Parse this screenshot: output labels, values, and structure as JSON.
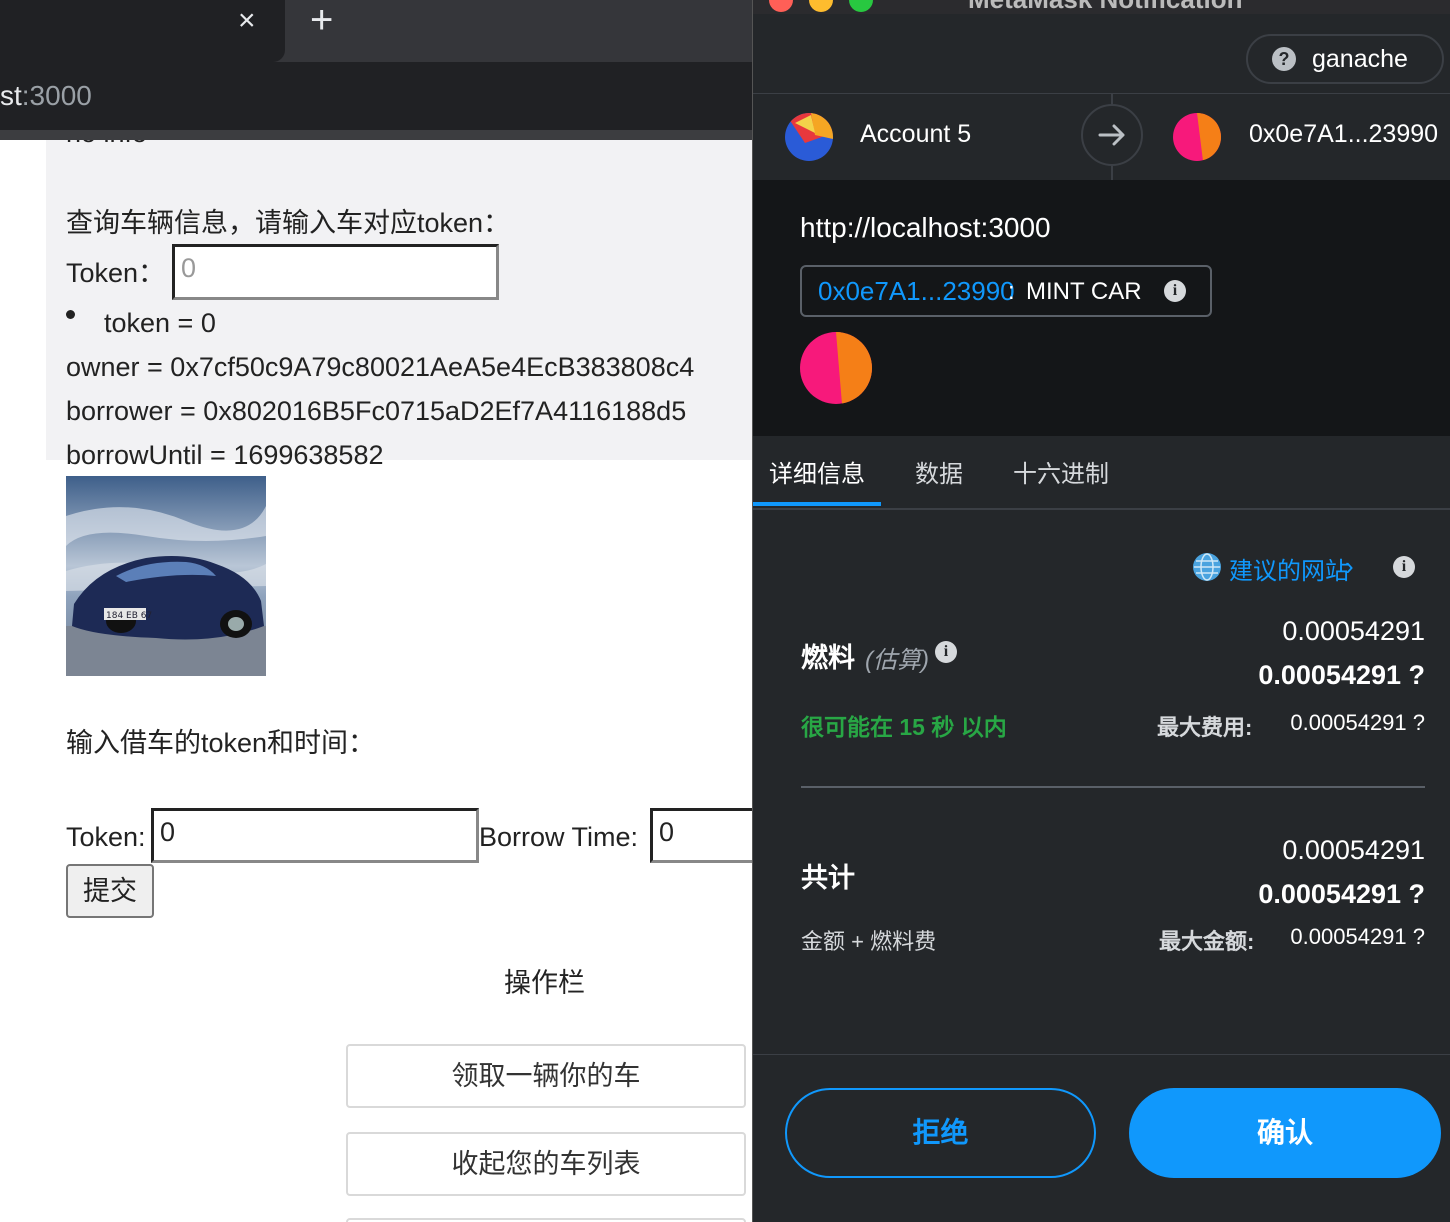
{
  "browser": {
    "tab_close": "×",
    "new_tab": "+",
    "url_host": "st",
    "url_port": ":3000"
  },
  "page": {
    "cut_text": "no info",
    "query_title": "查询车辆信息，请输入车对应token：",
    "token_label": "Token：",
    "token_placeholder": "0",
    "token_line": "token = 0",
    "owner_line": "owner = 0x7cf50c9A79c80021AeA5e4EcB383808c4",
    "borrower_line": "borrower = 0x802016B5Fc0715aD2Ef7A4116188d5",
    "borrow_until_line": "borrowUntil = 1699638582",
    "car_plate": "184 EB 67",
    "borrow_title": "输入借车的token和时间：",
    "borrow_token_label": "Token:",
    "borrow_token_value": "0",
    "borrow_time_label": "Borrow Time:",
    "borrow_time_value": "0",
    "submit_label": "提交",
    "ops_title": "操作栏",
    "op_buttons": [
      "领取一辆你的车",
      "收起您的车列表"
    ]
  },
  "metamask": {
    "window_title": "MetaMask Notification",
    "network": "ganache",
    "network_icon": "?",
    "from_account": "Account 5",
    "to_address": "0x0e7A1...23990",
    "origin": "http://localhost:3000",
    "method_address": "0x0e7A1...23990",
    "method_sep": ":",
    "method_name": "MINT CAR",
    "tabs": [
      "详细信息",
      "数据",
      "十六进制"
    ],
    "suggested_site": "建议的网站",
    "gas_label": "燃料",
    "gas_estimate": "(估算)",
    "gas_value": "0.00054291",
    "gas_value_bold": "0.00054291 ?",
    "gas_time": "很可能在 15 秒 以内",
    "max_fee_label": "最大费用:",
    "max_fee_value": "0.00054291 ?",
    "total_label": "共计",
    "total_value": "0.00054291",
    "total_value_bold": "0.00054291 ?",
    "amount_plus_gas": "金额 + 燃料费",
    "max_amount_label": "最大金额:",
    "max_amount_value": "0.00054291 ?",
    "reject_label": "拒绝",
    "confirm_label": "确认",
    "colors": {
      "accent": "#1098fc",
      "success": "#28a745",
      "bg": "#24272a"
    }
  }
}
